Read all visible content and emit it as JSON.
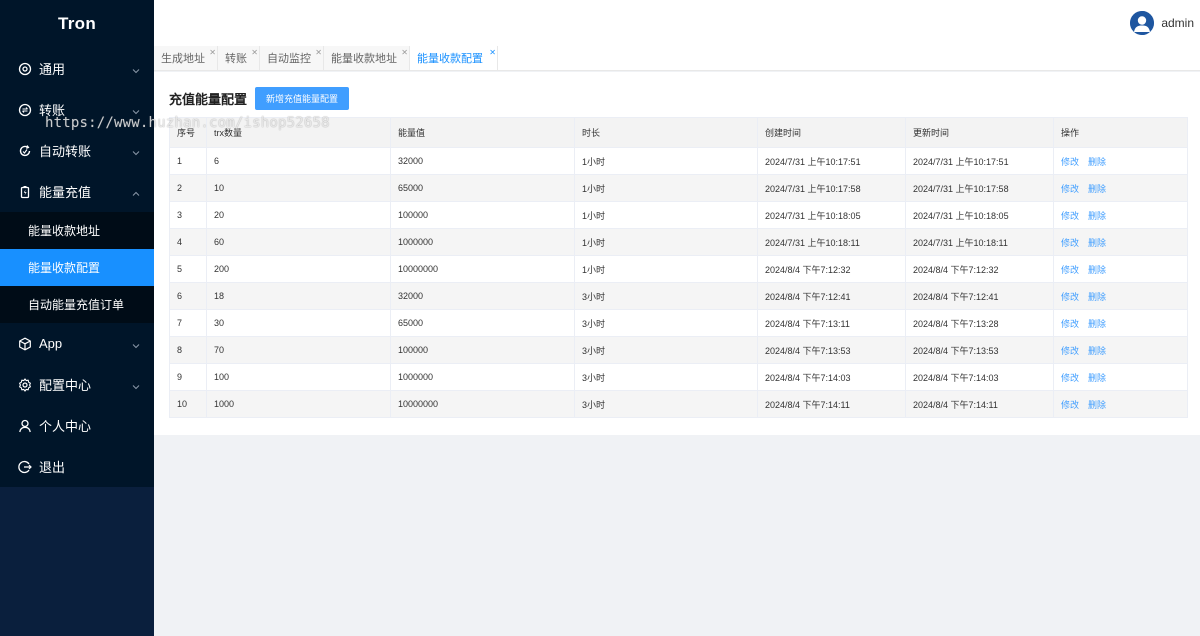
{
  "app": {
    "logo": "Tron"
  },
  "sidebar": {
    "items": [
      {
        "label": "通用",
        "icon": "settings-circle-icon",
        "expandable": true
      },
      {
        "label": "转账",
        "icon": "transfer-icon",
        "expandable": true
      },
      {
        "label": "自动转账",
        "icon": "refresh-icon",
        "expandable": true
      },
      {
        "label": "能量充值",
        "icon": "battery-icon",
        "expandable": true,
        "expanded": true,
        "children": [
          {
            "label": "能量收款地址"
          },
          {
            "label": "能量收款配置",
            "active": true
          },
          {
            "label": "自动能量充值订单"
          }
        ]
      },
      {
        "label": "App",
        "icon": "cube-icon",
        "expandable": true
      },
      {
        "label": "配置中心",
        "icon": "gear-icon",
        "expandable": true
      },
      {
        "label": "个人中心",
        "icon": "user-icon",
        "expandable": false
      },
      {
        "label": "退出",
        "icon": "logout-icon",
        "expandable": false
      }
    ]
  },
  "header": {
    "username": "admin"
  },
  "tabs": [
    {
      "label": "生成地址"
    },
    {
      "label": "转账"
    },
    {
      "label": "自动监控"
    },
    {
      "label": "能量收款地址"
    },
    {
      "label": "能量收款配置",
      "active": true
    }
  ],
  "page": {
    "title": "充值能量配置",
    "add_button": "新增充值能量配置",
    "columns": [
      "序号",
      "trx数量",
      "能量值",
      "时长",
      "创建时间",
      "更新时间",
      "操作"
    ],
    "edit_label": "修改",
    "delete_label": "删除",
    "rows": [
      [
        "1",
        "6",
        "32000",
        "1小时",
        "2024/7/31 上午10:17:51",
        "2024/7/31 上午10:17:51"
      ],
      [
        "2",
        "10",
        "65000",
        "1小时",
        "2024/7/31 上午10:17:58",
        "2024/7/31 上午10:17:58"
      ],
      [
        "3",
        "20",
        "100000",
        "1小时",
        "2024/7/31 上午10:18:05",
        "2024/7/31 上午10:18:05"
      ],
      [
        "4",
        "60",
        "1000000",
        "1小时",
        "2024/7/31 上午10:18:11",
        "2024/7/31 上午10:18:11"
      ],
      [
        "5",
        "200",
        "10000000",
        "1小时",
        "2024/8/4 下午7:12:32",
        "2024/8/4 下午7:12:32"
      ],
      [
        "6",
        "18",
        "32000",
        "3小时",
        "2024/8/4 下午7:12:41",
        "2024/8/4 下午7:12:41"
      ],
      [
        "7",
        "30",
        "65000",
        "3小时",
        "2024/8/4 下午7:13:11",
        "2024/8/4 下午7:13:28"
      ],
      [
        "8",
        "70",
        "100000",
        "3小时",
        "2024/8/4 下午7:13:53",
        "2024/8/4 下午7:13:53"
      ],
      [
        "9",
        "100",
        "1000000",
        "3小时",
        "2024/8/4 下午7:14:03",
        "2024/8/4 下午7:14:03"
      ],
      [
        "10",
        "1000",
        "10000000",
        "3小时",
        "2024/8/4 下午7:14:11",
        "2024/8/4 下午7:14:11"
      ]
    ]
  },
  "watermark": "https://www.huzhan.com/ishop52658",
  "colors": {
    "sidebar": "#001529",
    "accent": "#1890ff",
    "button": "#409eff"
  }
}
